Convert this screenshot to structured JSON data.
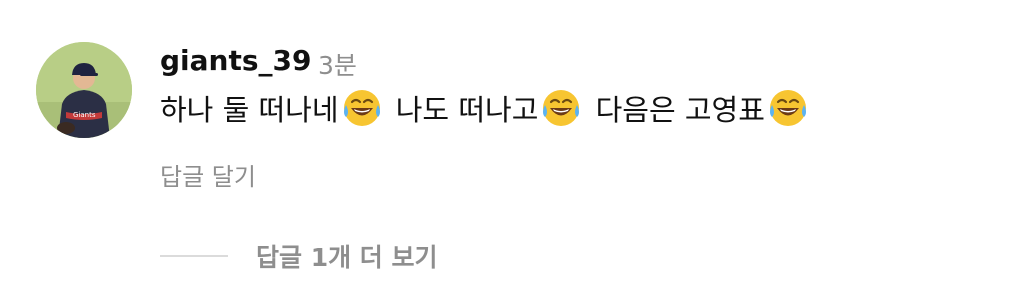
{
  "comment": {
    "username": "giants_39",
    "time": "3분",
    "segments": [
      {
        "text": "하나 둘 떠나네",
        "emoji": "laughing-crying-emoji"
      },
      {
        "text": " 나도 떠나고",
        "emoji": "laughing-crying-emoji"
      },
      {
        "text": " 다음은 고영표",
        "emoji": "laughing-crying-emoji"
      }
    ],
    "reply_label": "답글 달기"
  },
  "replies": {
    "view_label": "답글 1개 더 보기"
  },
  "avatar": {
    "icon": "profile-avatar-baseball-player"
  }
}
